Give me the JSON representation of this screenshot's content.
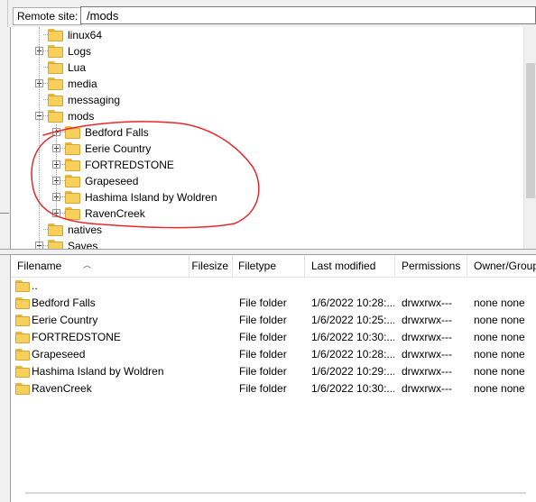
{
  "remote_site": {
    "label": "Remote site:",
    "path": "/mods"
  },
  "tree": {
    "items": [
      {
        "label": "linux64",
        "expander": "none"
      },
      {
        "label": "Logs",
        "expander": "plus"
      },
      {
        "label": "Lua",
        "expander": "none"
      },
      {
        "label": "media",
        "expander": "plus"
      },
      {
        "label": "messaging",
        "expander": "none"
      },
      {
        "label": "mods",
        "expander": "minus"
      },
      {
        "label": "Bedford Falls",
        "expander": "plus"
      },
      {
        "label": "Eerie Country",
        "expander": "plus"
      },
      {
        "label": "FORTREDSTONE",
        "expander": "plus"
      },
      {
        "label": "Grapeseed",
        "expander": "plus"
      },
      {
        "label": "Hashima Island by Woldren",
        "expander": "plus"
      },
      {
        "label": "RavenCreek",
        "expander": "plus"
      },
      {
        "label": "natives",
        "expander": "none"
      },
      {
        "label": "Saves",
        "expander": "minus"
      }
    ]
  },
  "columns": {
    "filename": "Filename",
    "filesize": "Filesize",
    "filetype": "Filetype",
    "last_modified": "Last modified",
    "permissions": "Permissions",
    "owner_group": "Owner/Group"
  },
  "files": [
    {
      "name": "..",
      "size": "",
      "type": "",
      "modified": "",
      "perms": "",
      "owner": ""
    },
    {
      "name": "Bedford Falls",
      "size": "",
      "type": "File folder",
      "modified": "1/6/2022 10:28:...",
      "perms": "drwxrwx---",
      "owner": "none none"
    },
    {
      "name": "Eerie Country",
      "size": "",
      "type": "File folder",
      "modified": "1/6/2022 10:25:...",
      "perms": "drwxrwx---",
      "owner": "none none"
    },
    {
      "name": "FORTREDSTONE",
      "size": "",
      "type": "File folder",
      "modified": "1/6/2022 10:30:...",
      "perms": "drwxrwx---",
      "owner": "none none"
    },
    {
      "name": "Grapeseed",
      "size": "",
      "type": "File folder",
      "modified": "1/6/2022 10:28:...",
      "perms": "drwxrwx---",
      "owner": "none none"
    },
    {
      "name": "Hashima Island by Woldren",
      "size": "",
      "type": "File folder",
      "modified": "1/6/2022 10:29:...",
      "perms": "drwxrwx---",
      "owner": "none none"
    },
    {
      "name": "RavenCreek",
      "size": "",
      "type": "File folder",
      "modified": "1/6/2022 10:30:...",
      "perms": "drwxrwx---",
      "owner": "none none"
    }
  ],
  "colors": {
    "annotation": "#e8262c",
    "folder": "#f7cf5b"
  }
}
